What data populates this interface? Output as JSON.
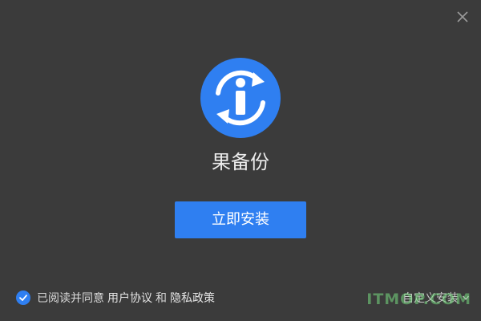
{
  "app": {
    "name": "果备份"
  },
  "buttons": {
    "install_label": "立即安装",
    "custom_install_label": "自定义安装"
  },
  "agreement": {
    "prefix": "已阅读并同意",
    "user_agreement": "用户协议",
    "conjunction": "和",
    "privacy_policy": "隐私政策",
    "checked": true
  },
  "watermark": "ITMOP.COM",
  "colors": {
    "background": "#3b3b3b",
    "accent": "#2f7ff1",
    "text": "#ededed"
  },
  "icons": {
    "close": "close-icon",
    "logo": "info-sync-logo-icon",
    "check": "checkmark-icon",
    "chevron": "chevron-down-icon"
  }
}
